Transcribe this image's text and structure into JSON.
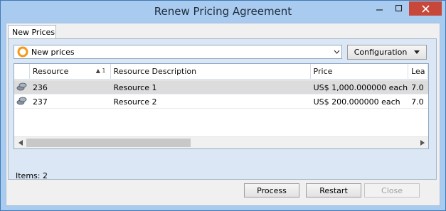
{
  "window": {
    "title": "Renew Pricing Agreement"
  },
  "tabs": [
    {
      "label": "New Prices"
    }
  ],
  "combo": {
    "value": "New prices"
  },
  "configuration_button": {
    "label": "Configuration"
  },
  "grid": {
    "columns": [
      "Resource",
      "Resource Description",
      "Price",
      "Lea"
    ],
    "sort_indicator": "▲ 1",
    "rows": [
      {
        "resource": "236",
        "description": "Resource 1",
        "price": "US$ 1,000.000000 each",
        "lea": "7.0"
      },
      {
        "resource": "237",
        "description": "Resource 2",
        "price": "US$ 200.000000 each",
        "lea": "7.0"
      }
    ]
  },
  "footer": {
    "items_text": "Items: 2"
  },
  "buttons": {
    "process": "Process",
    "restart": "Restart",
    "close": "Close"
  }
}
